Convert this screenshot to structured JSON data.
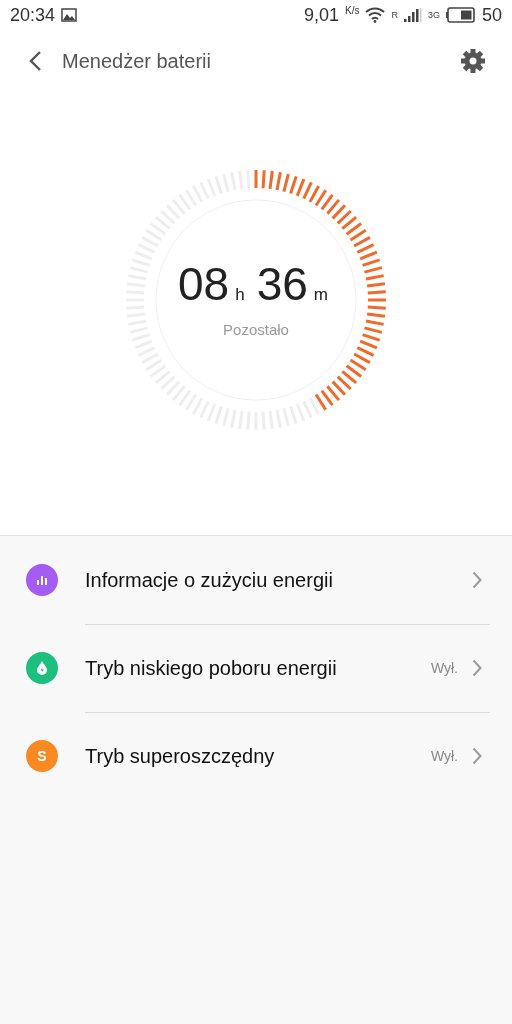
{
  "status_bar": {
    "time": "20:34",
    "speed": "9,01",
    "speed_unit": "K/s",
    "roaming": "R",
    "network": "3G",
    "battery": "50"
  },
  "header": {
    "title": "Menedżer baterii"
  },
  "gauge": {
    "hours": "08",
    "hours_unit": "h",
    "minutes": "36",
    "minutes_unit": "m",
    "caption": "Pozostało"
  },
  "items": [
    {
      "kind": "chart",
      "color": "#a45cf2",
      "label": "Informacje o zużyciu energii"
    },
    {
      "kind": "drop",
      "color": "#1dbf7f",
      "label": "Tryb niskiego poboru energii",
      "value": "Wył."
    },
    {
      "kind": "letter",
      "color": "#f98a23",
      "icon_text": "S",
      "label": "Tryb superoszczędny",
      "value": "Wył."
    }
  ]
}
